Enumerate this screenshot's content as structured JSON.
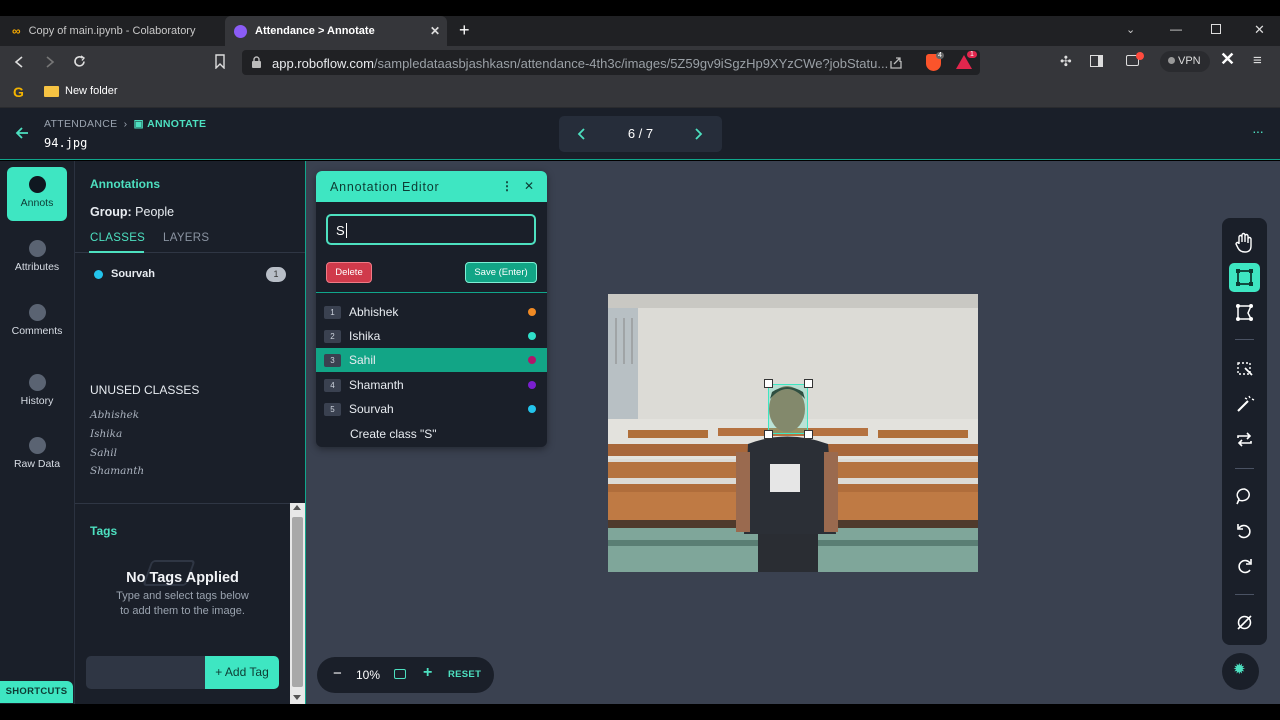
{
  "browser": {
    "tabs": [
      {
        "title": "Copy of main.ipynb - Colaboratory",
        "active": false
      },
      {
        "title": "Attendance > Annotate",
        "active": true
      }
    ],
    "url_host": "app.roboflow.com",
    "url_path": "/sampledataasbjashkasn/attendance-4th3c/images/5Z59gv9iSgzHp9XYzCWe?jobStatu...",
    "vpn_label": "VPN",
    "shield_badge": "4",
    "alert_badge": "1",
    "bookmark_folder": "New folder"
  },
  "header": {
    "breadcrumb_parent": "ATTENDANCE",
    "breadcrumb_current": "ANNOTATE",
    "filename": "94.jpg",
    "pager": "6 / 7"
  },
  "rail": {
    "items": [
      "Annots",
      "Attributes",
      "Comments",
      "History",
      "Raw Data"
    ],
    "shortcuts": "SHORTCUTS"
  },
  "panel": {
    "title": "Annotations",
    "group_label": "Group:",
    "group_value": "People",
    "tab_classes": "CLASSES",
    "tab_layers": "LAYERS",
    "class_name": "Sourvah",
    "class_count": "1",
    "unused_title": "UNUSED CLASSES",
    "unused": [
      "Abhishek",
      "Ishika",
      "Sahil",
      "Shamanth"
    ],
    "tags_title": "Tags",
    "no_tags": "No Tags Applied",
    "tags_hint_1": "Type and select tags below",
    "tags_hint_2": "to add them to the image.",
    "add_tag": "+ Add Tag"
  },
  "editor": {
    "title": "Annotation Editor",
    "input_value": "S",
    "delete": "Delete",
    "save": "Save (Enter)",
    "options": [
      {
        "num": "1",
        "name": "Abhishek",
        "color": "#f08a24"
      },
      {
        "num": "2",
        "name": "Ishika",
        "color": "#2fe0c9"
      },
      {
        "num": "3",
        "name": "Sahil",
        "color": "#b0166a"
      },
      {
        "num": "4",
        "name": "Shamanth",
        "color": "#7a1fd0"
      },
      {
        "num": "5",
        "name": "Sourvah",
        "color": "#23c4ec"
      }
    ],
    "create": "Create class \"S\""
  },
  "zoom": {
    "value": "10%",
    "reset": "RESET"
  },
  "colors": {
    "accent": "#3ee6c2",
    "dark_bg": "#1a1f29",
    "canvas_bg": "#3a4150",
    "danger": "#d03a4b"
  }
}
